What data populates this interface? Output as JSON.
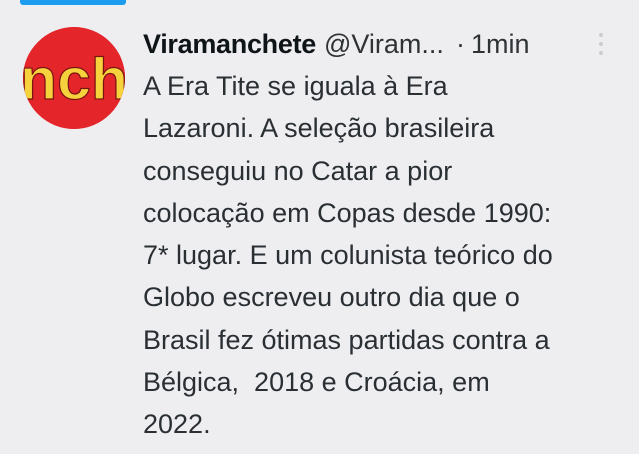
{
  "tweet": {
    "author": {
      "display_name": "Viramanchete",
      "handle": "@Viram...",
      "avatar_text": "nch",
      "avatar_bg": "#e4262b",
      "avatar_text_color": "#f6d33c"
    },
    "separator": "·",
    "timestamp": "1min",
    "more_icon": "more-vertical-icon",
    "text_lines": [
      "A Era Tite se iguala à Era",
      "Lazaroni. A seleção brasileira",
      "conseguiu no Catar a pior",
      "colocação em Copas desde 1990:",
      "7* lugar. E um colunista teórico do",
      "Globo escreveu outro dia que o",
      "Brasil fez ótimas partidas contra a",
      "Bélgica,  2018 e Croácia, em",
      "2022."
    ]
  },
  "colors": {
    "background": "#eeeef0",
    "accent": "#1d9bf0",
    "text": "#0f1419"
  }
}
